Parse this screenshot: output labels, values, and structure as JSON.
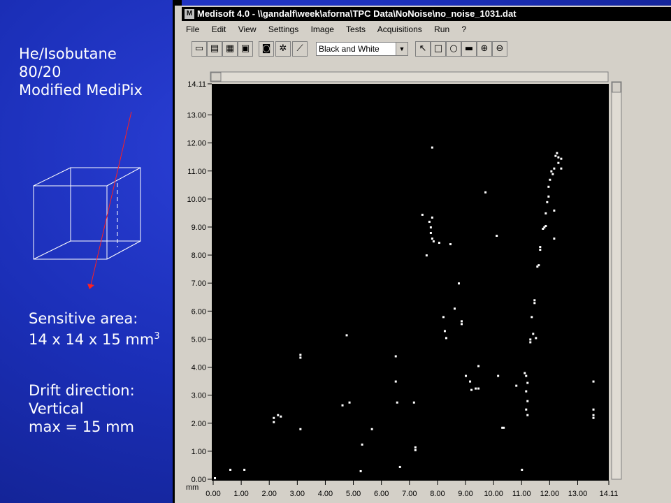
{
  "slide": {
    "gas_line1": "He/Isobutane",
    "gas_line2": "80/20",
    "detector": "Modified MediPix",
    "sensitive_label": "Sensitive area:",
    "sensitive_value": "14 x 14 x 15 mm",
    "sensitive_exp": "3",
    "drift_label": "Drift direction:",
    "drift_value": "Vertical",
    "drift_max": "max = 15 mm"
  },
  "window": {
    "title": "Medisoft 4.0 - \\\\gandalf\\week\\aforna\\TPC Data\\NoNoise\\no_noise_1031.dat",
    "menu": [
      "File",
      "Edit",
      "View",
      "Settings",
      "Image",
      "Tests",
      "Acquisitions",
      "Run",
      "?"
    ],
    "display_mode": "Black and White",
    "colors": {
      "plot_bg": "#000000",
      "hits": "#ffffff",
      "window_bg": "#d4d0c8"
    }
  },
  "chart_data": {
    "type": "scatter",
    "xlabel": "mm",
    "ylabel": "",
    "xlim": [
      0,
      14.11
    ],
    "ylim": [
      0,
      14.11
    ],
    "x_ticks": [
      "0.00",
      "1.00",
      "2.00",
      "3.00",
      "4.00",
      "5.00",
      "6.00",
      "7.00",
      "8.00",
      "9.00",
      "10.00",
      "11.00",
      "12.00",
      "13.00",
      "14.11"
    ],
    "y_ticks": [
      "0.00",
      "1.00",
      "2.00",
      "3.00",
      "4.00",
      "5.00",
      "6.00",
      "7.00",
      "8.00",
      "9.00",
      "10.00",
      "11.00",
      "12.00",
      "13.00",
      "14.11"
    ],
    "points": [
      [
        0.05,
        0.05
      ],
      [
        0.6,
        0.35
      ],
      [
        1.1,
        0.35
      ],
      [
        2.15,
        2.05
      ],
      [
        2.15,
        2.2
      ],
      [
        2.3,
        2.3
      ],
      [
        2.4,
        2.25
      ],
      [
        3.1,
        4.35
      ],
      [
        3.1,
        4.45
      ],
      [
        3.1,
        1.8
      ],
      [
        4.75,
        5.15
      ],
      [
        4.6,
        2.65
      ],
      [
        4.85,
        2.75
      ],
      [
        5.3,
        1.25
      ],
      [
        5.25,
        0.3
      ],
      [
        5.65,
        1.8
      ],
      [
        6.5,
        4.4
      ],
      [
        6.5,
        3.5
      ],
      [
        6.55,
        2.75
      ],
      [
        6.65,
        0.45
      ],
      [
        7.15,
        2.75
      ],
      [
        7.2,
        1.15
      ],
      [
        7.2,
        1.05
      ],
      [
        7.45,
        9.45
      ],
      [
        7.6,
        8.0
      ],
      [
        7.7,
        9.2
      ],
      [
        7.75,
        9.0
      ],
      [
        7.75,
        8.8
      ],
      [
        7.8,
        8.6
      ],
      [
        7.8,
        9.35
      ],
      [
        7.8,
        11.85
      ],
      [
        7.85,
        8.5
      ],
      [
        8.05,
        8.45
      ],
      [
        8.2,
        5.8
      ],
      [
        8.25,
        5.3
      ],
      [
        8.3,
        5.05
      ],
      [
        8.45,
        8.4
      ],
      [
        8.6,
        6.1
      ],
      [
        8.75,
        7.0
      ],
      [
        8.85,
        5.65
      ],
      [
        8.85,
        5.55
      ],
      [
        9.0,
        3.7
      ],
      [
        9.15,
        3.5
      ],
      [
        9.2,
        3.2
      ],
      [
        9.35,
        3.25
      ],
      [
        9.45,
        4.05
      ],
      [
        9.45,
        3.25
      ],
      [
        9.7,
        10.25
      ],
      [
        10.1,
        8.7
      ],
      [
        10.15,
        3.7
      ],
      [
        10.3,
        1.85
      ],
      [
        10.35,
        1.85
      ],
      [
        10.8,
        3.35
      ],
      [
        11.0,
        0.35
      ],
      [
        11.1,
        3.8
      ],
      [
        11.15,
        3.7
      ],
      [
        11.15,
        3.15
      ],
      [
        11.2,
        3.45
      ],
      [
        11.2,
        2.8
      ],
      [
        11.15,
        2.5
      ],
      [
        11.2,
        2.3
      ],
      [
        11.3,
        5.0
      ],
      [
        11.3,
        4.9
      ],
      [
        11.35,
        5.8
      ],
      [
        11.4,
        5.2
      ],
      [
        11.45,
        6.3
      ],
      [
        11.45,
        6.4
      ],
      [
        11.5,
        5.05
      ],
      [
        11.55,
        7.6
      ],
      [
        11.6,
        7.65
      ],
      [
        11.65,
        8.3
      ],
      [
        11.65,
        8.2
      ],
      [
        11.75,
        8.95
      ],
      [
        11.8,
        9.0
      ],
      [
        11.85,
        9.05
      ],
      [
        11.85,
        9.5
      ],
      [
        11.9,
        9.9
      ],
      [
        11.95,
        10.1
      ],
      [
        11.95,
        10.45
      ],
      [
        12.0,
        10.7
      ],
      [
        12.05,
        11.0
      ],
      [
        12.1,
        10.9
      ],
      [
        12.15,
        9.6
      ],
      [
        12.15,
        11.1
      ],
      [
        12.15,
        8.6
      ],
      [
        12.2,
        11.55
      ],
      [
        12.25,
        11.65
      ],
      [
        12.3,
        11.3
      ],
      [
        12.3,
        11.5
      ],
      [
        12.4,
        11.45
      ],
      [
        12.4,
        11.1
      ],
      [
        13.55,
        3.5
      ],
      [
        13.55,
        2.5
      ],
      [
        13.55,
        2.3
      ],
      [
        13.55,
        2.2
      ]
    ]
  }
}
